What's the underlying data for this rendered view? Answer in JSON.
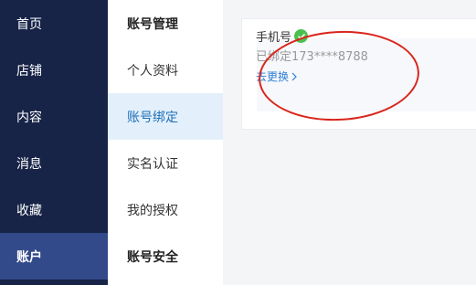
{
  "nav": {
    "items": [
      {
        "label": "首页"
      },
      {
        "label": "店铺"
      },
      {
        "label": "内容"
      },
      {
        "label": "消息"
      },
      {
        "label": "收藏"
      },
      {
        "label": "账户",
        "active": true
      }
    ]
  },
  "submenu": {
    "group_account_mgmt": "账号管理",
    "item_profile": "个人资料",
    "item_binding": "账号绑定",
    "item_realname": "实名认证",
    "item_authorization": "我的授权",
    "group_account_security": "账号安全"
  },
  "binding_card": {
    "title": "手机号",
    "status_icon": "check-circle-icon",
    "bound_text": "已绑定173****8788",
    "change_label": "去更换",
    "change_icon": "chevron-right-icon"
  },
  "colors": {
    "nav_bg": "#172447",
    "nav_active_bg": "#32498a",
    "submenu_active_bg": "#e3f0fb",
    "submenu_active_text": "#1e6fb8",
    "link": "#2f7fd6",
    "success": "#4cc04e",
    "annotation": "#d9261c"
  }
}
